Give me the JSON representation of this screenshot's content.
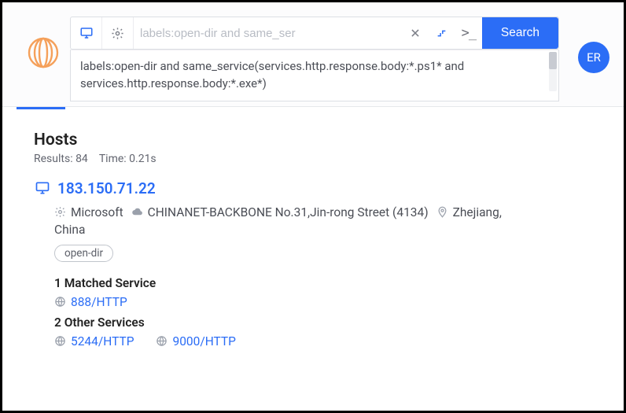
{
  "header": {
    "search_placeholder": "labels:open-dir and same_ser",
    "search_button": "Search",
    "query_text": "labels:open-dir and same_service(services.http.response.body:*.ps1* and services.http.response.body:*.exe*)",
    "avatar_initials": "ER"
  },
  "results": {
    "section_title": "Hosts",
    "count_label": "Results: 84",
    "time_label": "Time: 0.21s",
    "host": {
      "ip": "183.150.71.22",
      "os": "Microsoft",
      "asn": "CHINANET-BACKBONE No.31,Jin-rong Street (4134)",
      "location_part1": "Zhejiang,",
      "location_part2": "China",
      "label_chip": "open-dir",
      "matched_heading": "1 Matched Service",
      "matched_services": [
        "888/HTTP"
      ],
      "other_heading": "2 Other Services",
      "other_services": [
        "5244/HTTP",
        "9000/HTTP"
      ]
    }
  },
  "icons": {
    "monitor": "monitor-icon",
    "gear": "gear-icon",
    "clear": "close-icon",
    "collapse": "collapse-icon",
    "terminal": "terminal-icon",
    "os": "gear-icon",
    "cloud": "cloud-icon",
    "pin": "pin-icon",
    "globe": "globe-icon"
  }
}
